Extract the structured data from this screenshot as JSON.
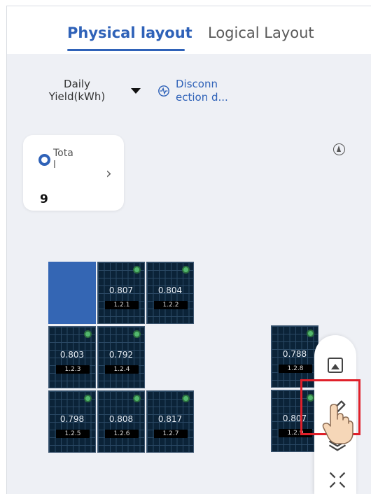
{
  "tabs": {
    "active": "Physical layout",
    "inactive": "Logical Layout"
  },
  "toolbar_row": {
    "metric_line1": "Daily",
    "metric_line2": "Yield(kWh)",
    "disconnection_line1": "Disconn",
    "disconnection_line2": "ection d..."
  },
  "summary_card": {
    "label_line1": "Tota",
    "label_line2": "l",
    "value": "9"
  },
  "panels": [
    {
      "value": "",
      "id": "",
      "selected": true
    },
    {
      "value": "0.807",
      "id": "1.2.1"
    },
    {
      "value": "0.804",
      "id": "1.2.2"
    },
    {
      "value": "0.803",
      "id": "1.2.3"
    },
    {
      "value": "0.792",
      "id": "1.2.4"
    },
    {
      "value": "0.798",
      "id": "1.2.5"
    },
    {
      "value": "0.808",
      "id": "1.2.6"
    },
    {
      "value": "0.817",
      "id": "1.2.7"
    },
    {
      "value": "0.788",
      "id": "1.2.8"
    },
    {
      "value": "0.807",
      "id": "1.2.9"
    }
  ],
  "colors": {
    "accent": "#2f62b8",
    "panel_bg": "#0b2338",
    "selected_panel": "#3466b4",
    "online_dot": "#53b86e",
    "highlight": "#e0202a"
  },
  "icons": {
    "disconnection": "heartbeat-circle-icon",
    "compass": "compass-icon",
    "image_tool": "image-icon",
    "edit_tool": "pen-icon",
    "layers_tool": "layers-icon",
    "shrink_tool": "collapse-icon",
    "cursor": "hand-pointer-icon"
  }
}
